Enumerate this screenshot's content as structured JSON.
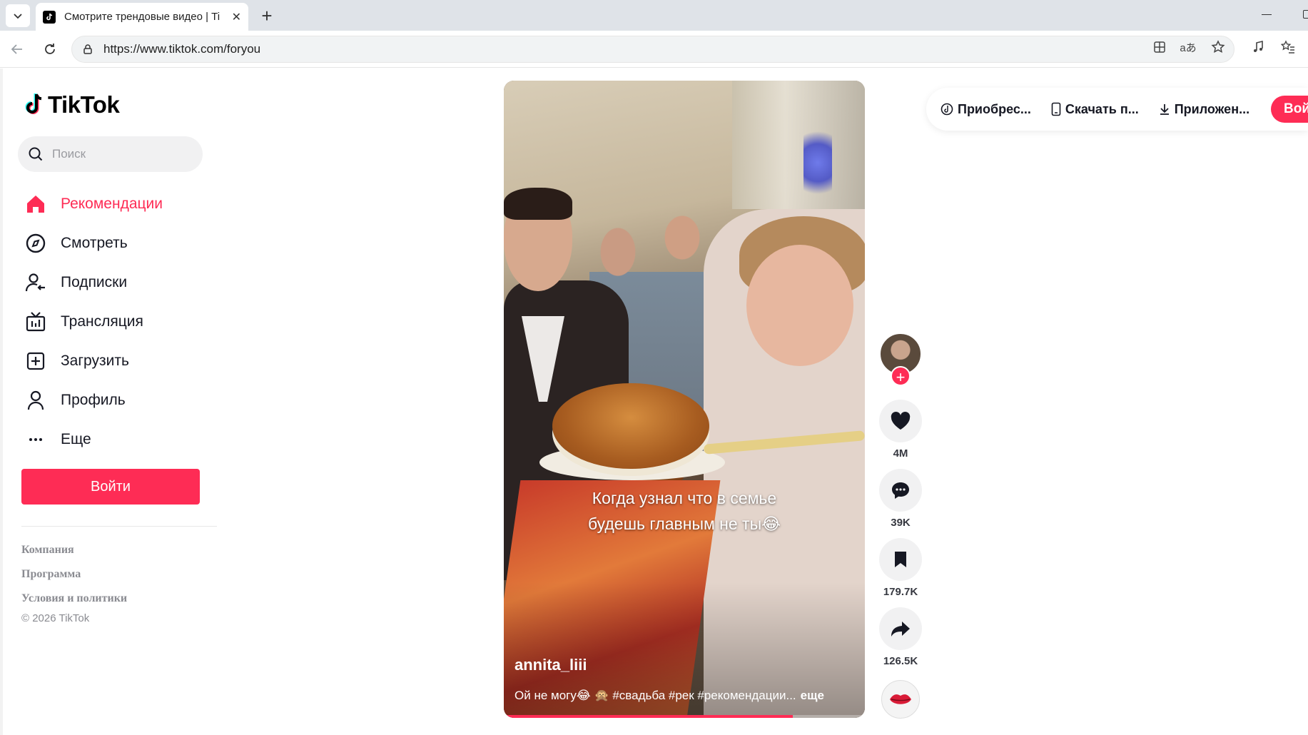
{
  "browser": {
    "tab_title": "Смотрите трендовые видео | TikTok",
    "url": "https://www.tiktok.com/foryou"
  },
  "sidebar": {
    "logo": "TikTok",
    "search_placeholder": "Поиск",
    "items": [
      {
        "label": "Рекомендации",
        "icon": "home-icon",
        "active": true
      },
      {
        "label": "Смотреть",
        "icon": "compass-icon",
        "active": false
      },
      {
        "label": "Подписки",
        "icon": "following-icon",
        "active": false
      },
      {
        "label": "Трансляция",
        "icon": "live-tv-icon",
        "active": false
      },
      {
        "label": "Загрузить",
        "icon": "upload-icon",
        "active": false
      },
      {
        "label": "Профиль",
        "icon": "profile-icon",
        "active": false
      },
      {
        "label": "Еще",
        "icon": "more-icon",
        "active": false
      }
    ],
    "login": "Войти",
    "footer": [
      "Компания",
      "Программа",
      "Условия и политики"
    ],
    "copyright": "© 2026 TikTok"
  },
  "video": {
    "caption_line1": "Когда узнал что в семье",
    "caption_line2": "будешь главным не ты😂",
    "username": "annita_liii",
    "description": "Ой не могу😂 🙊 #свадьба #рек #рекомендации...",
    "more": "еще",
    "progress": 0.8
  },
  "actions": {
    "likes": "4M",
    "comments": "39K",
    "saves": "179.7K",
    "shares": "126.5K"
  },
  "promo": {
    "coins": "Приобрес...",
    "download_app": "Скачать п...",
    "app": "Приложен...",
    "login": "Вой"
  },
  "colors": {
    "accent": "#fe2c55",
    "text": "#161823",
    "muted": "#8a8b91"
  }
}
